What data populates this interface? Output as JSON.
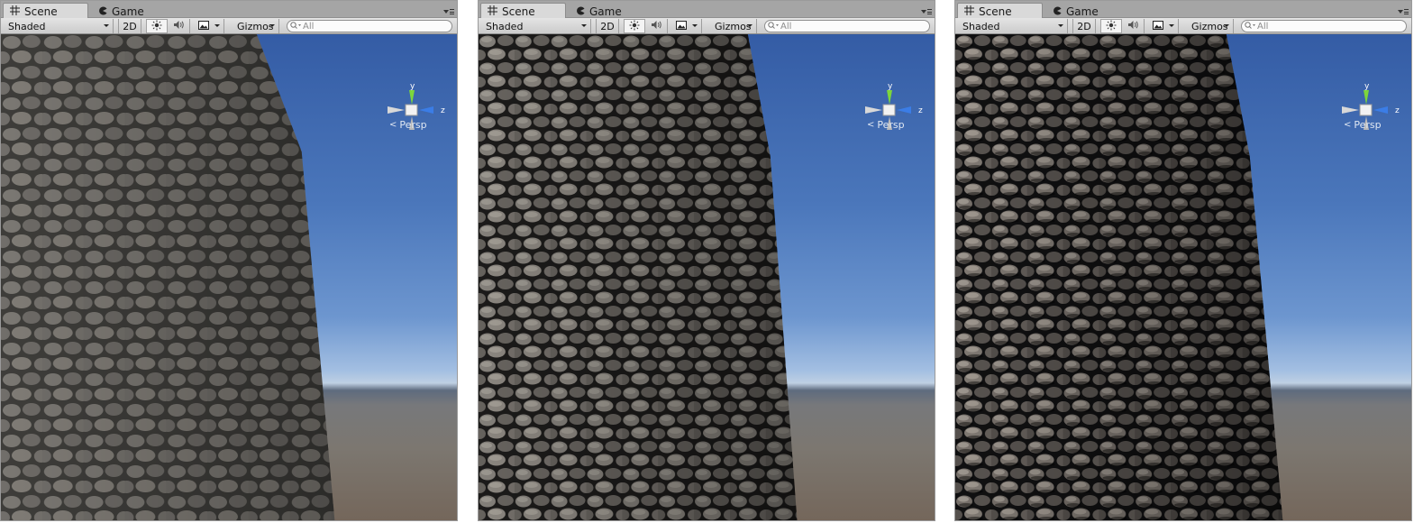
{
  "panels": [
    {
      "tabs": {
        "scene": "Scene",
        "game": "Game"
      },
      "toolbar": {
        "draw_mode": "Shaded",
        "mode_2d": "2D",
        "gizmos": "Gizmos",
        "search_placeholder": "All"
      },
      "gizmo": {
        "y_axis": "y",
        "z_axis": "z",
        "projection": "Persp"
      },
      "wall_style": "flat"
    },
    {
      "tabs": {
        "scene": "Scene",
        "game": "Game"
      },
      "toolbar": {
        "draw_mode": "Shaded",
        "mode_2d": "2D",
        "gizmos": "Gizmos",
        "search_placeholder": "All"
      },
      "gizmo": {
        "y_axis": "y",
        "z_axis": "z",
        "projection": "Persp"
      },
      "wall_style": "relief"
    },
    {
      "tabs": {
        "scene": "Scene",
        "game": "Game"
      },
      "toolbar": {
        "draw_mode": "Shaded",
        "mode_2d": "2D",
        "gizmos": "Gizmos",
        "search_placeholder": "All"
      },
      "gizmo": {
        "y_axis": "y",
        "z_axis": "z",
        "projection": "Persp"
      },
      "wall_style": "deep-relief"
    }
  ],
  "colors": {
    "y_axis": "#7dd63b",
    "z_axis": "#3b7de6",
    "x_axis": "#d8d8d8",
    "sky": "#4b77bb",
    "stone": "#6f6c68"
  },
  "icons": [
    "grid-icon",
    "pacman-icon",
    "sun-icon",
    "speaker-icon",
    "image-icon",
    "menu-icon",
    "search-icon",
    "chevron-left-icon"
  ]
}
